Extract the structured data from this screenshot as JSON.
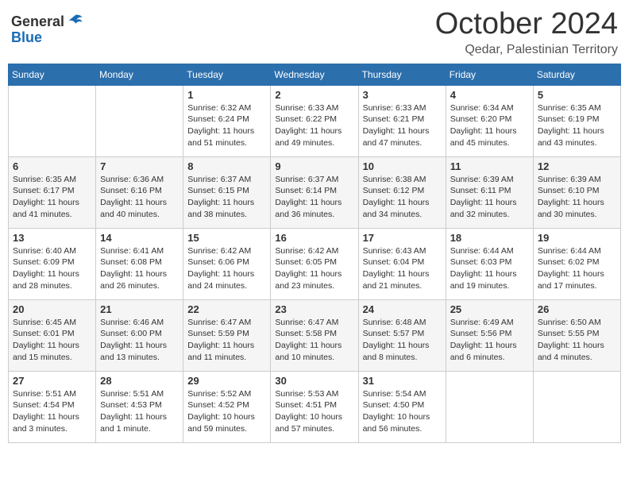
{
  "header": {
    "logo": {
      "general": "General",
      "blue": "Blue"
    },
    "month": "October 2024",
    "location": "Qedar, Palestinian Territory"
  },
  "weekdays": [
    "Sunday",
    "Monday",
    "Tuesday",
    "Wednesday",
    "Thursday",
    "Friday",
    "Saturday"
  ],
  "weeks": [
    [
      {
        "day": null,
        "info": null
      },
      {
        "day": null,
        "info": null
      },
      {
        "day": "1",
        "info": "Sunrise: 6:32 AM\nSunset: 6:24 PM\nDaylight: 11 hours and 51 minutes."
      },
      {
        "day": "2",
        "info": "Sunrise: 6:33 AM\nSunset: 6:22 PM\nDaylight: 11 hours and 49 minutes."
      },
      {
        "day": "3",
        "info": "Sunrise: 6:33 AM\nSunset: 6:21 PM\nDaylight: 11 hours and 47 minutes."
      },
      {
        "day": "4",
        "info": "Sunrise: 6:34 AM\nSunset: 6:20 PM\nDaylight: 11 hours and 45 minutes."
      },
      {
        "day": "5",
        "info": "Sunrise: 6:35 AM\nSunset: 6:19 PM\nDaylight: 11 hours and 43 minutes."
      }
    ],
    [
      {
        "day": "6",
        "info": "Sunrise: 6:35 AM\nSunset: 6:17 PM\nDaylight: 11 hours and 41 minutes."
      },
      {
        "day": "7",
        "info": "Sunrise: 6:36 AM\nSunset: 6:16 PM\nDaylight: 11 hours and 40 minutes."
      },
      {
        "day": "8",
        "info": "Sunrise: 6:37 AM\nSunset: 6:15 PM\nDaylight: 11 hours and 38 minutes."
      },
      {
        "day": "9",
        "info": "Sunrise: 6:37 AM\nSunset: 6:14 PM\nDaylight: 11 hours and 36 minutes."
      },
      {
        "day": "10",
        "info": "Sunrise: 6:38 AM\nSunset: 6:12 PM\nDaylight: 11 hours and 34 minutes."
      },
      {
        "day": "11",
        "info": "Sunrise: 6:39 AM\nSunset: 6:11 PM\nDaylight: 11 hours and 32 minutes."
      },
      {
        "day": "12",
        "info": "Sunrise: 6:39 AM\nSunset: 6:10 PM\nDaylight: 11 hours and 30 minutes."
      }
    ],
    [
      {
        "day": "13",
        "info": "Sunrise: 6:40 AM\nSunset: 6:09 PM\nDaylight: 11 hours and 28 minutes."
      },
      {
        "day": "14",
        "info": "Sunrise: 6:41 AM\nSunset: 6:08 PM\nDaylight: 11 hours and 26 minutes."
      },
      {
        "day": "15",
        "info": "Sunrise: 6:42 AM\nSunset: 6:06 PM\nDaylight: 11 hours and 24 minutes."
      },
      {
        "day": "16",
        "info": "Sunrise: 6:42 AM\nSunset: 6:05 PM\nDaylight: 11 hours and 23 minutes."
      },
      {
        "day": "17",
        "info": "Sunrise: 6:43 AM\nSunset: 6:04 PM\nDaylight: 11 hours and 21 minutes."
      },
      {
        "day": "18",
        "info": "Sunrise: 6:44 AM\nSunset: 6:03 PM\nDaylight: 11 hours and 19 minutes."
      },
      {
        "day": "19",
        "info": "Sunrise: 6:44 AM\nSunset: 6:02 PM\nDaylight: 11 hours and 17 minutes."
      }
    ],
    [
      {
        "day": "20",
        "info": "Sunrise: 6:45 AM\nSunset: 6:01 PM\nDaylight: 11 hours and 15 minutes."
      },
      {
        "day": "21",
        "info": "Sunrise: 6:46 AM\nSunset: 6:00 PM\nDaylight: 11 hours and 13 minutes."
      },
      {
        "day": "22",
        "info": "Sunrise: 6:47 AM\nSunset: 5:59 PM\nDaylight: 11 hours and 11 minutes."
      },
      {
        "day": "23",
        "info": "Sunrise: 6:47 AM\nSunset: 5:58 PM\nDaylight: 11 hours and 10 minutes."
      },
      {
        "day": "24",
        "info": "Sunrise: 6:48 AM\nSunset: 5:57 PM\nDaylight: 11 hours and 8 minutes."
      },
      {
        "day": "25",
        "info": "Sunrise: 6:49 AM\nSunset: 5:56 PM\nDaylight: 11 hours and 6 minutes."
      },
      {
        "day": "26",
        "info": "Sunrise: 6:50 AM\nSunset: 5:55 PM\nDaylight: 11 hours and 4 minutes."
      }
    ],
    [
      {
        "day": "27",
        "info": "Sunrise: 5:51 AM\nSunset: 4:54 PM\nDaylight: 11 hours and 3 minutes."
      },
      {
        "day": "28",
        "info": "Sunrise: 5:51 AM\nSunset: 4:53 PM\nDaylight: 11 hours and 1 minute."
      },
      {
        "day": "29",
        "info": "Sunrise: 5:52 AM\nSunset: 4:52 PM\nDaylight: 10 hours and 59 minutes."
      },
      {
        "day": "30",
        "info": "Sunrise: 5:53 AM\nSunset: 4:51 PM\nDaylight: 10 hours and 57 minutes."
      },
      {
        "day": "31",
        "info": "Sunrise: 5:54 AM\nSunset: 4:50 PM\nDaylight: 10 hours and 56 minutes."
      },
      {
        "day": null,
        "info": null
      },
      {
        "day": null,
        "info": null
      }
    ]
  ]
}
